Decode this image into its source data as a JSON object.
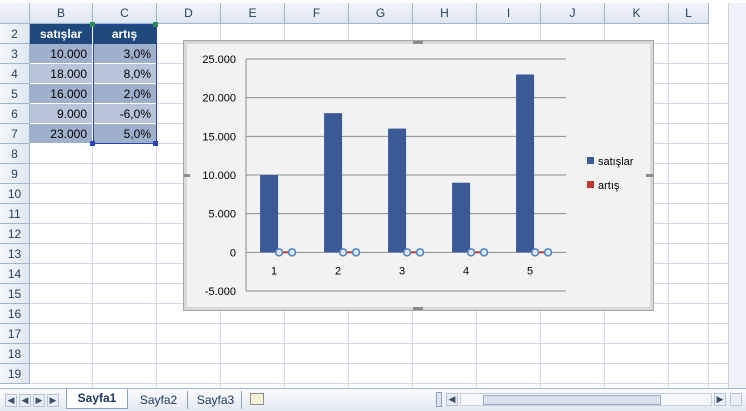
{
  "columns": [
    "B",
    "C",
    "D",
    "E",
    "F",
    "G",
    "H",
    "I",
    "J",
    "K",
    "L"
  ],
  "rows": [
    "2",
    "3",
    "4",
    "5",
    "6",
    "7",
    "8",
    "9",
    "10",
    "11",
    "12",
    "13",
    "14",
    "15",
    "16",
    "17",
    "18",
    "19"
  ],
  "table": {
    "headers": [
      "satışlar",
      "artış"
    ],
    "rows": [
      [
        "10.000",
        "3,0%"
      ],
      [
        "18.000",
        "8,0%"
      ],
      [
        "16.000",
        "2,0%"
      ],
      [
        "9.000",
        "-6,0%"
      ],
      [
        "23.000",
        "5,0%"
      ]
    ]
  },
  "chart_data": {
    "type": "bar",
    "categories": [
      "1",
      "2",
      "3",
      "4",
      "5"
    ],
    "series": [
      {
        "name": "satışlar",
        "values": [
          10000,
          18000,
          16000,
          9000,
          23000
        ],
        "color": "#3a5a95"
      },
      {
        "name": "artış",
        "values": [
          0.03,
          0.08,
          0.02,
          -0.06,
          0.05
        ],
        "color": "#c0392b"
      }
    ],
    "ylim": [
      -5000,
      25000
    ],
    "yticks": [
      "25.000",
      "20.000",
      "15.000",
      "10.000",
      "5.000",
      "0",
      "-5.000"
    ],
    "grid": true,
    "legend": "right"
  },
  "sheets": [
    "Sayfa1",
    "Sayfa2",
    "Sayfa3"
  ],
  "active_sheet": "Sayfa1",
  "nav_icons": [
    "first-sheet-icon",
    "prev-sheet-icon",
    "next-sheet-icon",
    "last-sheet-icon",
    "insert-sheet-icon"
  ]
}
